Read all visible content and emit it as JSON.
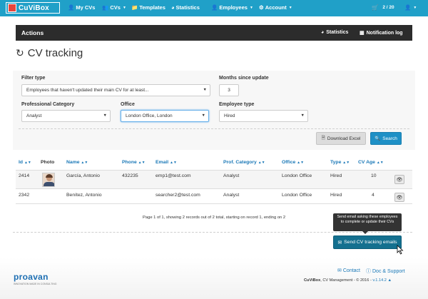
{
  "navbar": {
    "brand": "CuViBox",
    "items": [
      {
        "label": "My CVs",
        "icon": "user-icon",
        "has_caret": false
      },
      {
        "label": "CVs",
        "icon": "users-icon",
        "has_caret": true
      },
      {
        "label": "Templates",
        "icon": "folder-icon",
        "has_caret": false
      },
      {
        "label": "Statistics",
        "icon": "pie-chart-icon",
        "has_caret": false
      },
      {
        "label": "Employees",
        "icon": "user-icon",
        "has_caret": true
      },
      {
        "label": "Account",
        "icon": "gear-icon",
        "has_caret": true
      }
    ],
    "cart_count": "2 / 20"
  },
  "actions": {
    "title": "Actions",
    "statistics": "Statistics",
    "notification_log": "Notification log"
  },
  "page": {
    "title": "CV tracking"
  },
  "filter": {
    "filter_type_label": "Filter type",
    "filter_type_value": "Employees that haven't updated their main CV for at least...",
    "months_label": "Months since update",
    "months_value": "3",
    "prof_category_label": "Professional Category",
    "prof_category_value": "Analyst",
    "office_label": "Office",
    "office_value": "London Office, London",
    "employee_type_label": "Employee type",
    "employee_type_value": "Hired",
    "download_label": "Download Excel",
    "search_label": "Search"
  },
  "table": {
    "columns": [
      "Id",
      "Photo",
      "Name",
      "Phone",
      "Email",
      "Prof. Category",
      "Office",
      "Type",
      "CV Age"
    ],
    "rows": [
      {
        "id": "2414",
        "name": "García, Antonio",
        "phone": "432235",
        "email": "emp1@test.com",
        "category": "Analyst",
        "office": "London Office",
        "type": "Hired",
        "cv_age": "10",
        "has_photo": true
      },
      {
        "id": "2342",
        "name": "Benítez, Antonio",
        "phone": "",
        "email": "searcher2@test.com",
        "category": "Analyst",
        "office": "London Office",
        "type": "Hired",
        "cv_age": "4",
        "has_photo": false
      }
    ],
    "pager": "Page 1 of 1, showing 2 records out of 2 total, starting on record 1, ending on 2"
  },
  "tooltip": "Send email asking these employees to complete or update their CVs",
  "send_button": "Send CV tracking emails",
  "footer": {
    "company": "proavan",
    "company_tagline": "INNOVATION MADE IN CONSULTING",
    "contact": "Contact",
    "doc_support": "Doc & Support",
    "app_name": "CuViBox",
    "copyright": ", CV Management - © 2016 -",
    "version": "v.1.14.2"
  },
  "colors": {
    "navbar": "#20a0c8",
    "actions_bar": "#2c2c2c",
    "link": "#1a78b7",
    "primary_button": "#1e90c6",
    "send_button": "#14708f"
  }
}
